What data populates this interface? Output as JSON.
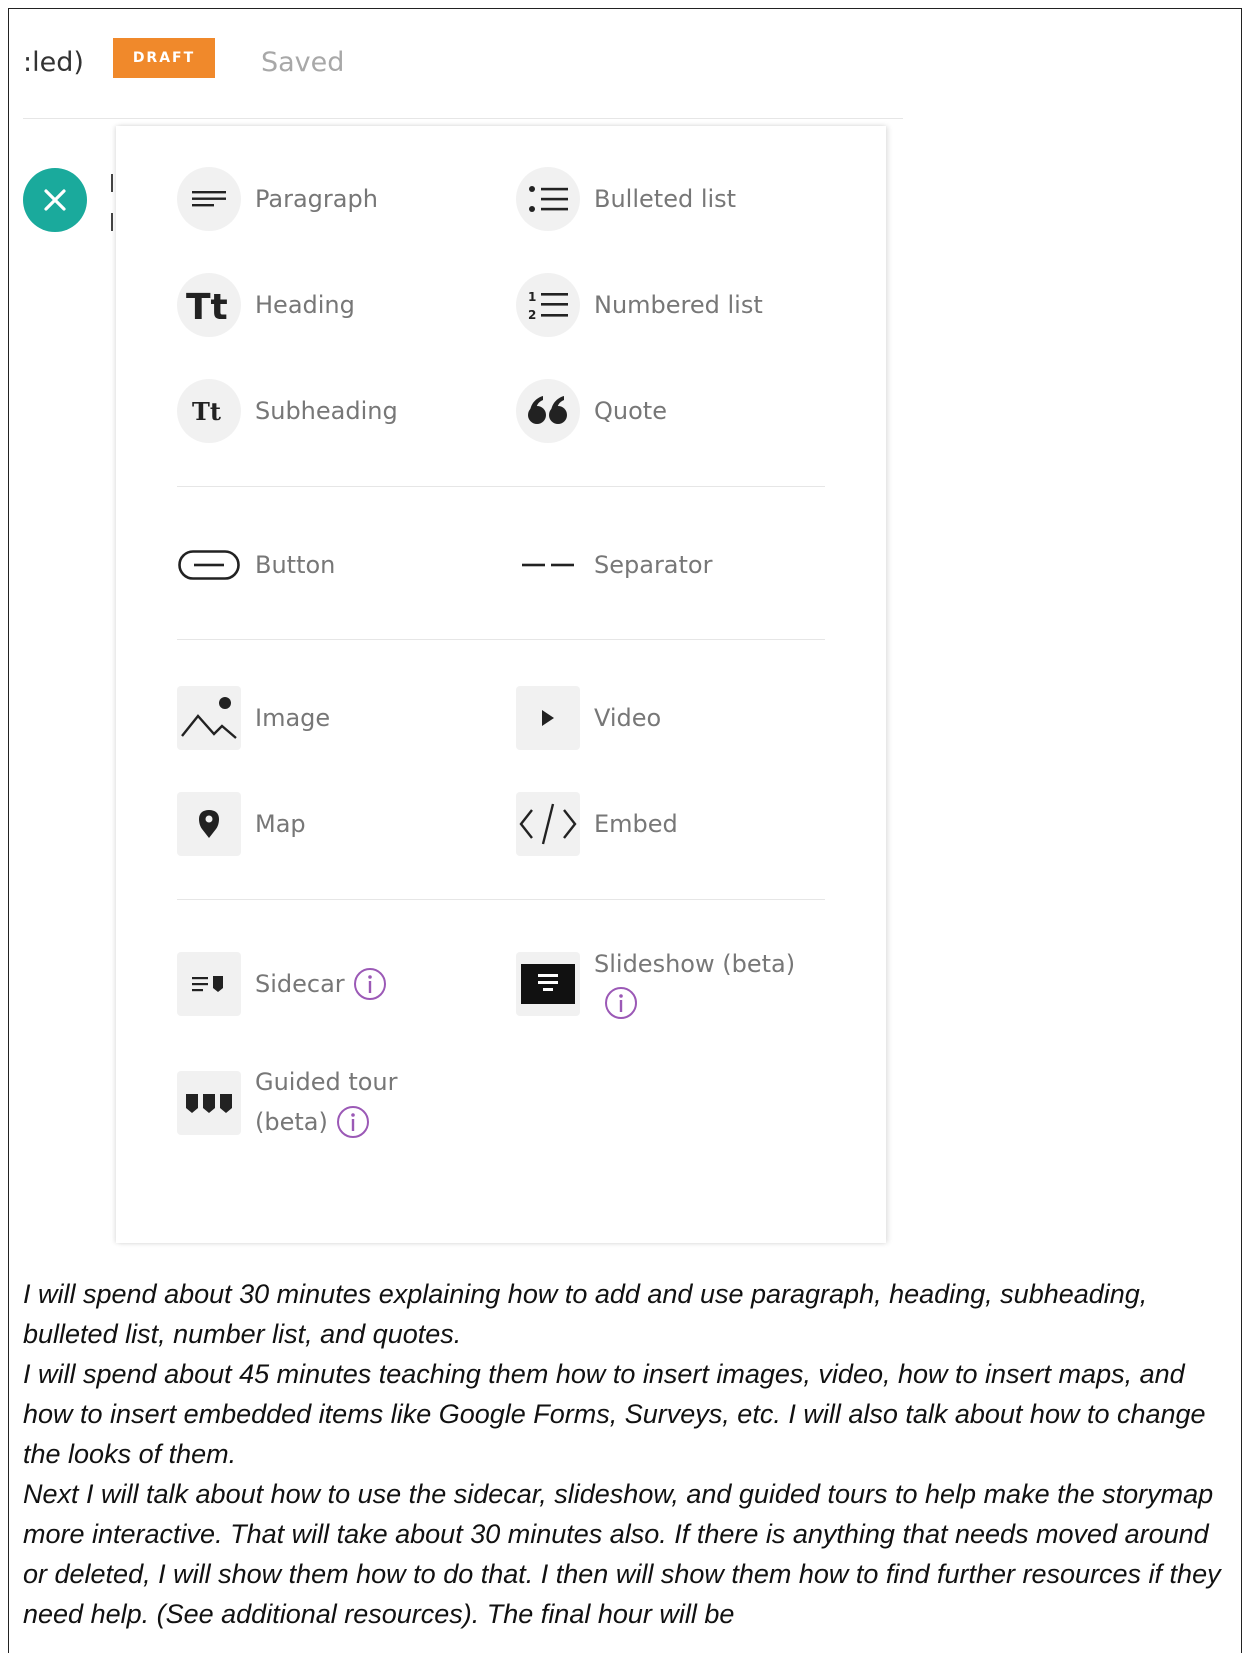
{
  "header": {
    "title_fragment": ":led)",
    "status_badge": "DRAFT",
    "save_status": "Saved"
  },
  "colors": {
    "badge_bg": "#f0892b",
    "close_button_bg": "#1aaa9c",
    "info_icon": "#9b59b6",
    "label_text": "#777777"
  },
  "menu": {
    "text_blocks": {
      "paragraph": "Paragraph",
      "bulleted_list": "Bulleted list",
      "heading": "Heading",
      "numbered_list": "Numbered list",
      "subheading": "Subheading",
      "quote": "Quote"
    },
    "layout_blocks": {
      "button": "Button",
      "separator": "Separator"
    },
    "media_blocks": {
      "image": "Image",
      "video": "Video",
      "map": "Map",
      "embed": "Embed"
    },
    "immersive_blocks": {
      "sidecar": "Sidecar",
      "slideshow": "Slideshow (beta)",
      "guided_tour_line1": "Guided tour",
      "guided_tour_line2": "(beta)"
    },
    "icons": {
      "close": "close-icon",
      "paragraph": "paragraph-icon",
      "bulleted_list": "bulleted-list-icon",
      "heading": "heading-icon",
      "numbered_list": "numbered-list-icon",
      "subheading": "subheading-icon",
      "quote": "quote-icon",
      "button": "button-icon",
      "separator": "separator-icon",
      "image": "image-icon",
      "video": "video-icon",
      "map": "map-pin-icon",
      "embed": "embed-code-icon",
      "sidecar": "sidecar-icon",
      "slideshow": "slideshow-icon",
      "guided_tour": "guided-tour-icon",
      "info": "info-icon"
    }
  },
  "description": {
    "p1": "I will spend about 30 minutes explaining how to add and use paragraph, heading, subheading, bulleted list, number list, and quotes.",
    "p2": "I will spend about 45 minutes teaching them how to insert images, video, how to insert maps, and how to insert embedded items like Google Forms, Surveys, etc. I will also talk about how to change the looks of them.",
    "p3": "Next I will talk about how to use the sidecar, slideshow, and guided tours to help make the storymap more interactive. That will take about 30 minutes also. If there is anything that needs moved around or deleted, I will show them how to do that. I then will show them how to find further resources if they need help. (See additional resources). The final hour will be"
  }
}
